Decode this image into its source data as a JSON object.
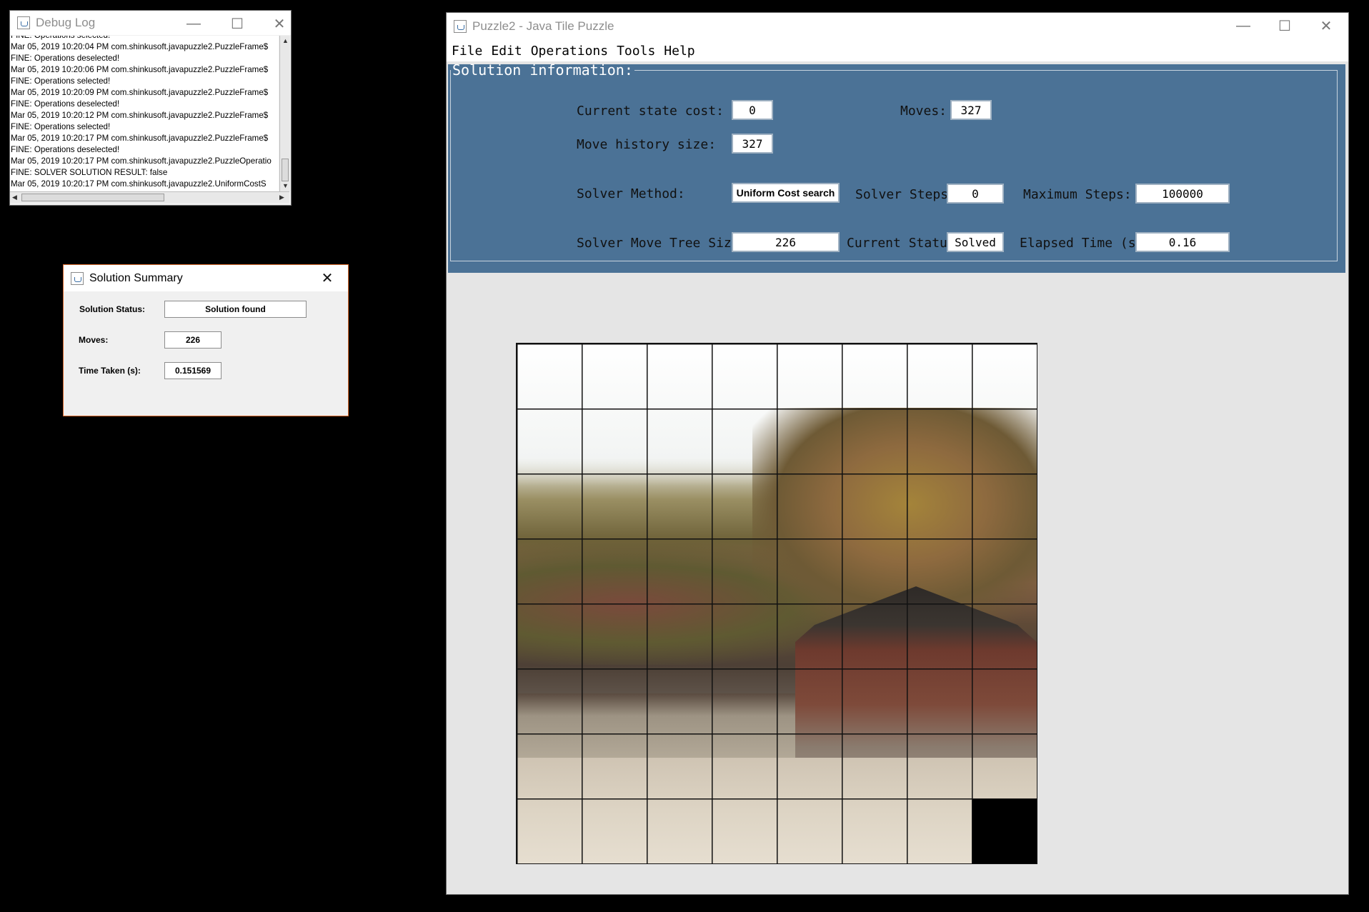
{
  "debug_window": {
    "title": "Debug Log",
    "lines": [
      "FINE: Operations selected!",
      "Mar 05, 2019 10:20:04 PM com.shinkusoft.javapuzzle2.PuzzleFrame$",
      "FINE: Operations deselected!",
      "Mar 05, 2019 10:20:06 PM com.shinkusoft.javapuzzle2.PuzzleFrame$",
      "FINE: Operations selected!",
      "Mar 05, 2019 10:20:09 PM com.shinkusoft.javapuzzle2.PuzzleFrame$",
      "FINE: Operations deselected!",
      "Mar 05, 2019 10:20:12 PM com.shinkusoft.javapuzzle2.PuzzleFrame$",
      "FINE: Operations selected!",
      "Mar 05, 2019 10:20:17 PM com.shinkusoft.javapuzzle2.PuzzleFrame$",
      "FINE: Operations deselected!",
      "Mar 05, 2019 10:20:17 PM com.shinkusoft.javapuzzle2.PuzzleOperatio",
      "FINE: SOLVER SOLUTION RESULT: false",
      "Mar 05, 2019 10:20:17 PM com.shinkusoft.javapuzzle2.UniformCostS"
    ]
  },
  "summary_window": {
    "title": "Solution Summary",
    "status_label": "Solution Status:",
    "status_value": "Solution found",
    "moves_label": "Moves:",
    "moves_value": "226",
    "time_label": "Time Taken (s):",
    "time_value": "0.151569"
  },
  "puzzle_window": {
    "title": "Puzzle2 - Java Tile Puzzle",
    "menu": [
      "File",
      "Edit",
      "Operations",
      "Tools",
      "Help"
    ],
    "panel": {
      "legend": "Solution information:",
      "current_state_cost_label": "Current state cost:",
      "current_state_cost_value": "0",
      "moves_label": "Moves:",
      "moves_value": "327",
      "move_history_label": "Move history size:",
      "move_history_value": "327",
      "solver_method_label": "Solver Method:",
      "solver_method_value": "Uniform Cost search",
      "solver_steps_label": "Solver Steps:",
      "solver_steps_value": "0",
      "max_steps_label": "Maximum Steps:",
      "max_steps_value": "100000",
      "tree_size_label": "Solver Move Tree Size:",
      "tree_size_value": "226",
      "current_status_label": "Current Status:",
      "current_status_value": "Solved",
      "elapsed_label": "Elapsed Time (s):",
      "elapsed_value": "0.16"
    },
    "board": {
      "rows": 8,
      "cols": 8,
      "blank_tile": "bottom-right"
    }
  },
  "colors": {
    "panel_bg": "#4b7296",
    "window_bg": "#e5e5e5",
    "desktop": "#000000"
  }
}
